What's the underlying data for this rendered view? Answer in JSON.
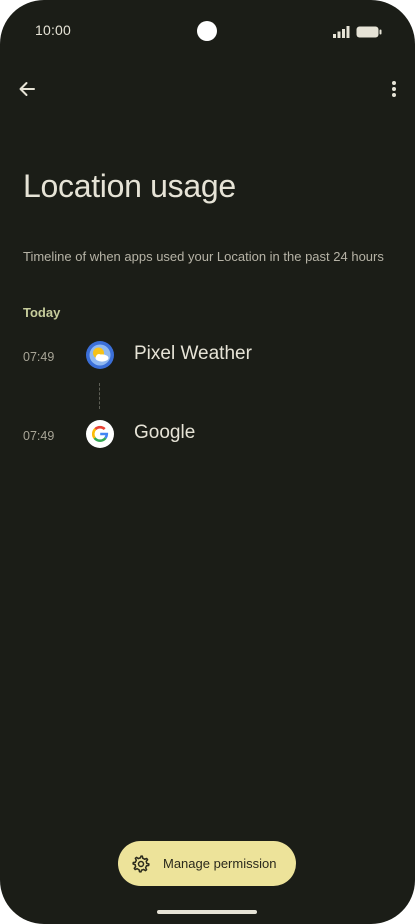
{
  "status_bar": {
    "time": "10:00",
    "icons": [
      "signal-icon",
      "battery-icon"
    ]
  },
  "app_bar": {
    "back_icon": "arrow-back-icon",
    "more_icon": "more-vert-icon"
  },
  "page": {
    "title": "Location usage",
    "subtitle": "Timeline of when apps used your Location in the past 24 hours",
    "section_header": "Today"
  },
  "timeline": [
    {
      "time": "07:49",
      "app": "Pixel Weather",
      "icon": "pixel-weather-icon"
    },
    {
      "time": "07:49",
      "app": "Google",
      "icon": "google-icon"
    }
  ],
  "action_button": {
    "label": "Manage permission",
    "icon": "gear-icon"
  },
  "colors": {
    "background": "#1b1d17",
    "primary_text": "#e6e3d6",
    "secondary_text": "#b6b3a6",
    "accent": "#c7cd9c",
    "button_bg": "#ede39a"
  }
}
